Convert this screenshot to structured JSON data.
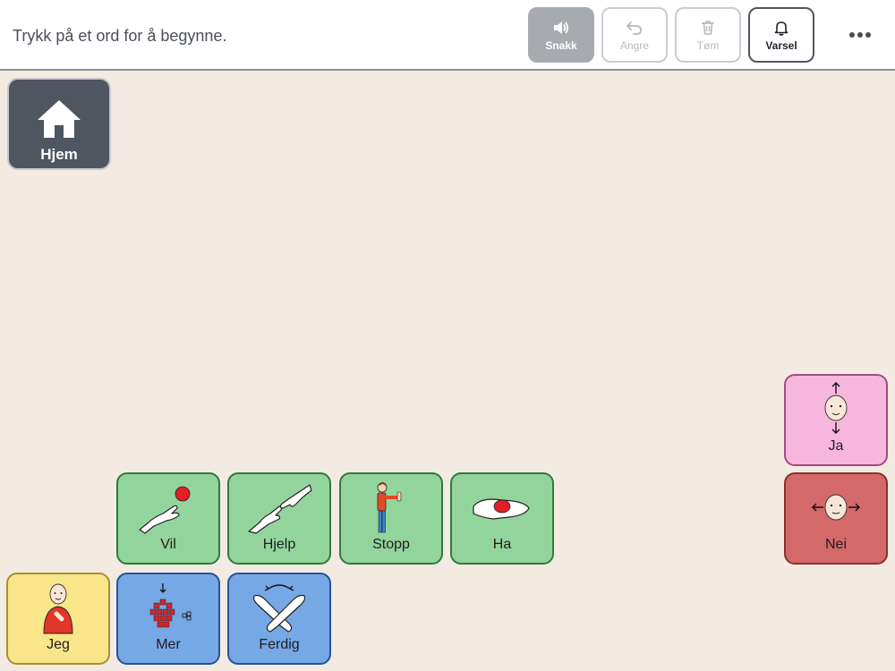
{
  "topbar": {
    "message": "Trykk på et ord for å begynne.",
    "speak_label": "Snakk",
    "undo_label": "Angre",
    "clear_label": "Tøm",
    "alert_label": "Varsel"
  },
  "tiles": {
    "home": "Hjem",
    "vil": "Vil",
    "hjelp": "Hjelp",
    "stopp": "Stopp",
    "ha": "Ha",
    "ja": "Ja",
    "nei": "Nei",
    "jeg": "Jeg",
    "mer": "Mer",
    "ferdig": "Ferdig"
  },
  "colors": {
    "background": "#f3ebe2",
    "home": "#4f5660",
    "verb_green": "#93d49d",
    "function_blue": "#76a8e6",
    "pronoun_yellow": "#f9e58a",
    "yes_pink": "#f7b6dd",
    "no_red": "#d4696a"
  },
  "icons": {
    "speak": "speaker-icon",
    "undo": "undo-arrow-icon",
    "clear": "trash-icon",
    "alert": "bell-icon",
    "more": "more-dots-icon",
    "home": "house-icon"
  }
}
